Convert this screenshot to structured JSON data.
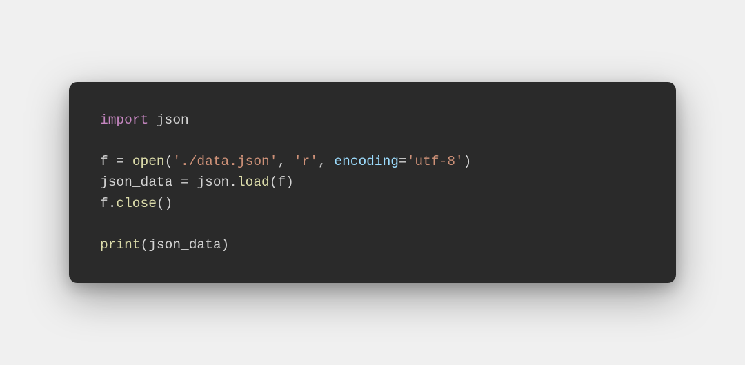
{
  "code": {
    "line1": {
      "import_kw": "import",
      "space1": " ",
      "module": "json"
    },
    "blank1": "",
    "line3": {
      "var": "f ",
      "equals": "=",
      "space1": " ",
      "open_fn": "open",
      "lparen": "(",
      "arg1": "'./data.json'",
      "comma1": ", ",
      "arg2": "'r'",
      "comma2": ", ",
      "kwarg": "encoding",
      "eq2": "=",
      "arg3": "'utf-8'",
      "rparen": ")"
    },
    "line4": {
      "var": "json_data ",
      "equals": "=",
      "space1": " ",
      "obj": "json",
      "dot": ".",
      "method": "load",
      "lparen": "(",
      "arg": "f",
      "rparen": ")"
    },
    "line5": {
      "obj": "f",
      "dot": ".",
      "method": "close",
      "lparen": "(",
      "rparen": ")"
    },
    "blank2": "",
    "line7": {
      "fn": "print",
      "lparen": "(",
      "arg": "json_data",
      "rparen": ")"
    }
  }
}
